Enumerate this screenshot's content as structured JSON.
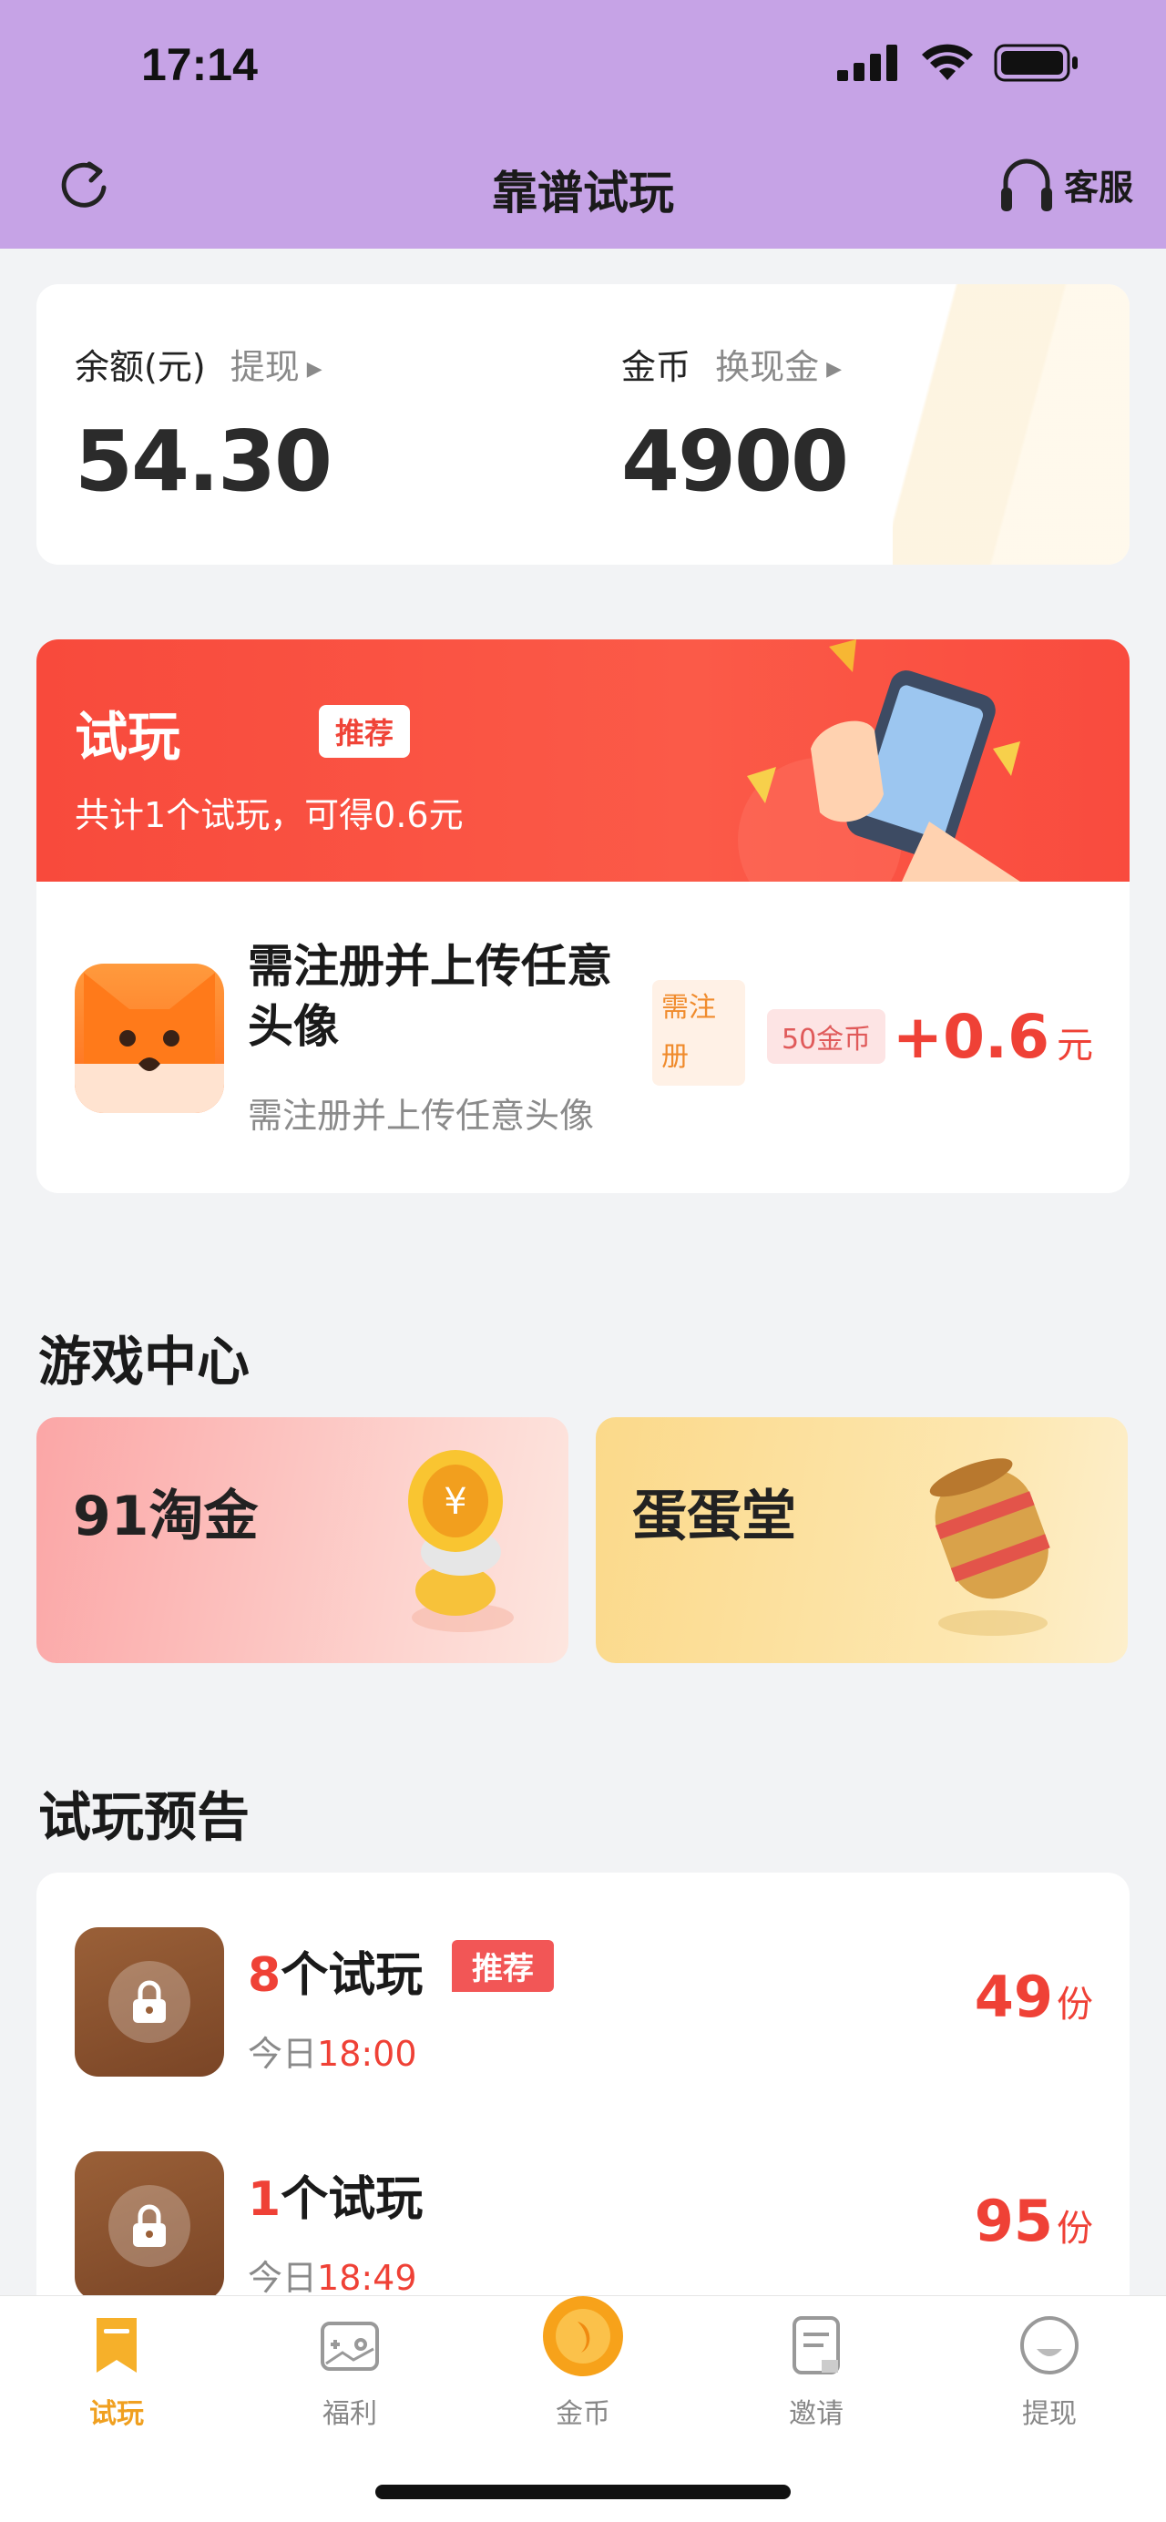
{
  "status": {
    "time": "17:14"
  },
  "nav": {
    "title": "靠谱试玩",
    "service_label": "客服"
  },
  "balance": {
    "balance_label": "余额(元)",
    "withdraw_link": "提现",
    "balance_value": "54.30",
    "coin_label": "金币",
    "exchange_link": "换现金",
    "coin_value": "4900"
  },
  "trial": {
    "title": "试玩",
    "badge": "推荐",
    "subtitle": "共计1个试玩，可得0.6元",
    "task": {
      "title": "需注册并上传任意头像",
      "description": "需注册并上传任意头像",
      "tag_register": "需注册",
      "tag_coins": "50金币",
      "reward": "+0.6",
      "reward_unit": "元"
    }
  },
  "game_center": {
    "title": "游戏中心",
    "games": [
      {
        "name": "91淘金"
      },
      {
        "name": "蛋蛋堂"
      }
    ]
  },
  "preview": {
    "title": "试玩预告",
    "items": [
      {
        "count": "8",
        "suffix": "个试玩",
        "badge": "推荐",
        "day": "今日",
        "time": "18:00",
        "shares": "49",
        "shares_unit": "份"
      },
      {
        "count": "1",
        "suffix": "个试玩",
        "day": "今日",
        "time": "18:49",
        "shares": "95",
        "shares_unit": "份"
      }
    ]
  },
  "tabs": [
    {
      "label": "试玩",
      "icon": "bookmark-icon",
      "active": true
    },
    {
      "label": "福利",
      "icon": "gamepad-icon",
      "active": false
    },
    {
      "label": "金币",
      "icon": "coin-icon",
      "active": false
    },
    {
      "label": "邀请",
      "icon": "document-icon",
      "active": false
    },
    {
      "label": "提现",
      "icon": "smile-icon",
      "active": false
    }
  ],
  "colors": {
    "header": "#c6a3e6",
    "accent_red": "#ef4136",
    "tab_active": "#f0a020"
  }
}
